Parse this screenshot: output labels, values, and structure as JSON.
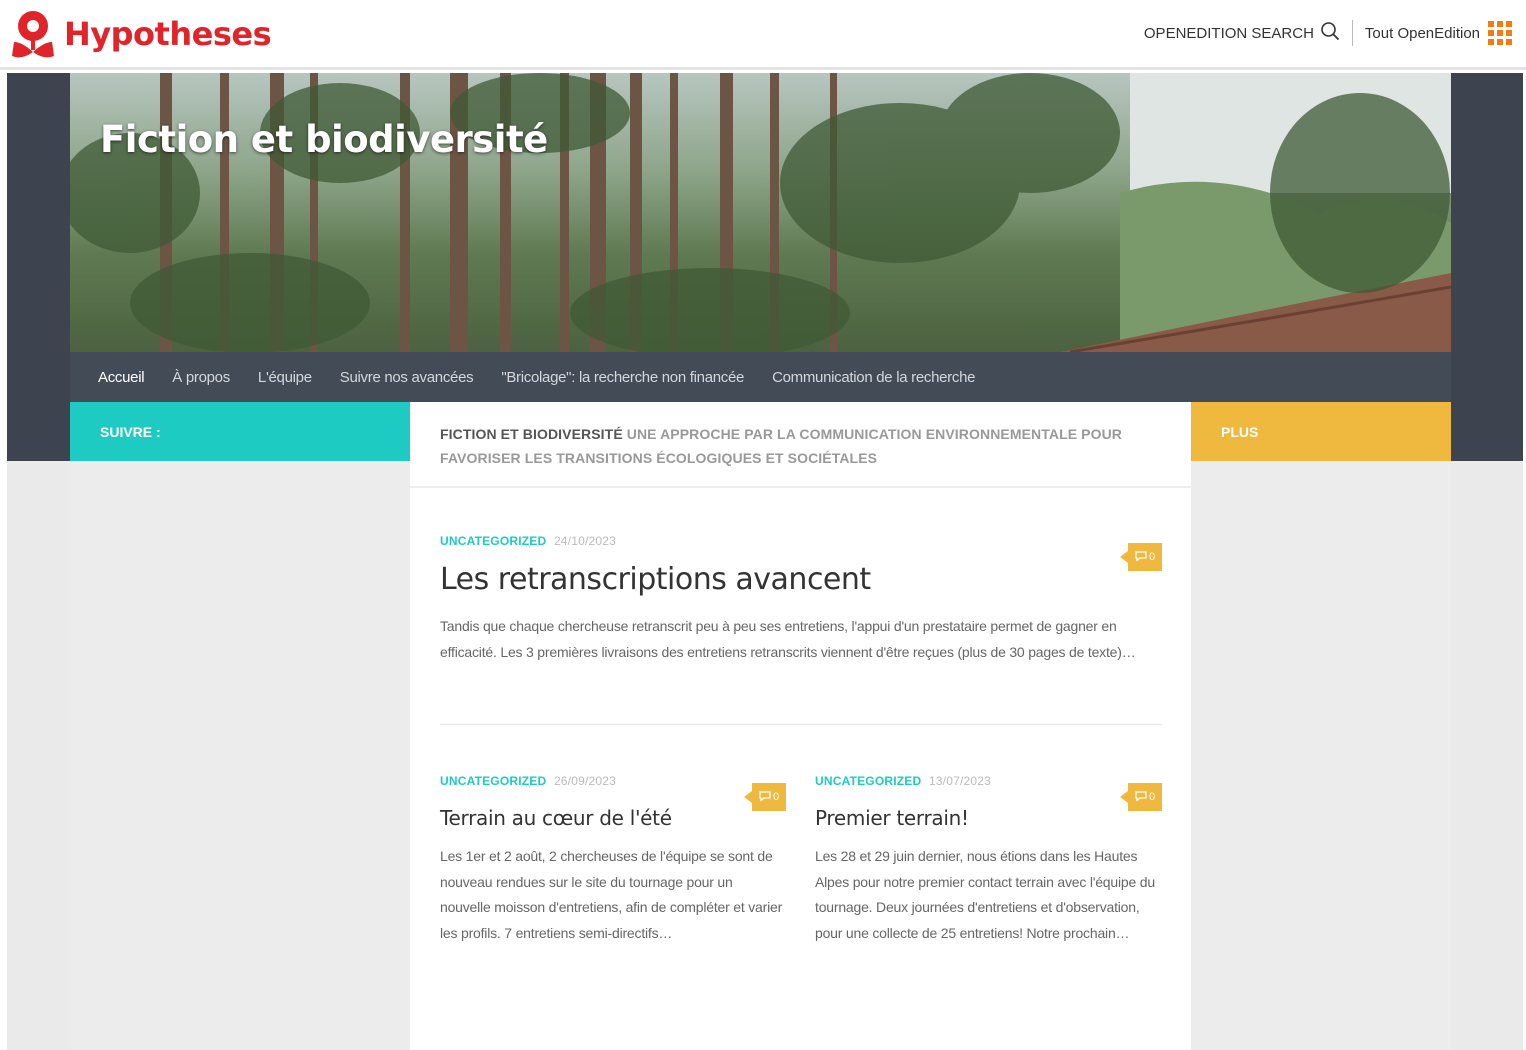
{
  "topbar": {
    "brand": "Hypotheses",
    "search_label": "OPENEDITION SEARCH",
    "tout_label": "Tout OpenEdition"
  },
  "site": {
    "title": "Fiction et biodiversité"
  },
  "nav": {
    "items": [
      {
        "label": "Accueil"
      },
      {
        "label": "À propos"
      },
      {
        "label": "L'équipe"
      },
      {
        "label": "Suivre nos avancées"
      },
      {
        "label": "\"Bricolage\": la recherche non financée"
      },
      {
        "label": "Communication de la recherche"
      }
    ]
  },
  "sidebar_left": {
    "heading": "SUIVRE :"
  },
  "sidebar_right": {
    "heading": "PLUS"
  },
  "tagline": {
    "name": "FICTION ET BIODIVERSITÉ",
    "description": "UNE APPROCHE PAR LA COMMUNICATION ENVIRONNEMENTALE POUR FAVORISER LES TRANSITIONS ÉCOLOGIQUES ET SOCIÉTALES"
  },
  "posts": [
    {
      "category": "UNCATEGORIZED",
      "date": "24/10/2023",
      "comments": "0",
      "title": "Les retranscriptions avancent",
      "excerpt": "Tandis que chaque chercheuse retranscrit peu à peu ses entretiens, l'appui d'un prestataire permet de gagner en efficacité. Les 3 premières livraisons des entretiens retranscrits viennent d'être reçues (plus de 30 pages de texte)…"
    },
    {
      "category": "UNCATEGORIZED",
      "date": "26/09/2023",
      "comments": "0",
      "title": "Terrain au cœur de l'été",
      "excerpt": "Les 1er et 2 août, 2 chercheuses de l'équipe se sont de nouveau rendues sur le site du tournage pour un nouvelle moisson d'entretiens, afin de compléter et varier les profils. 7 entretiens semi-directifs…"
    },
    {
      "category": "UNCATEGORIZED",
      "date": "13/07/2023",
      "comments": "0",
      "title": "Premier terrain!",
      "excerpt": "Les 28 et 29 juin dernier, nous étions dans les Hautes Alpes pour notre premier contact terrain avec l'équipe du tournage. Deux journées d'entretiens et d'observation, pour une collecte de 25 entretiens! Notre prochain…"
    }
  ],
  "colors": {
    "brand_red": "#e0242a",
    "teal": "#1ecbc2",
    "gold": "#efb93f",
    "dark": "#3d4450",
    "oe_orange": "#f07d12"
  },
  "icons": [
    "hypotheses-logo-icon",
    "search-icon",
    "apps-grid-icon",
    "comment-icon"
  ]
}
